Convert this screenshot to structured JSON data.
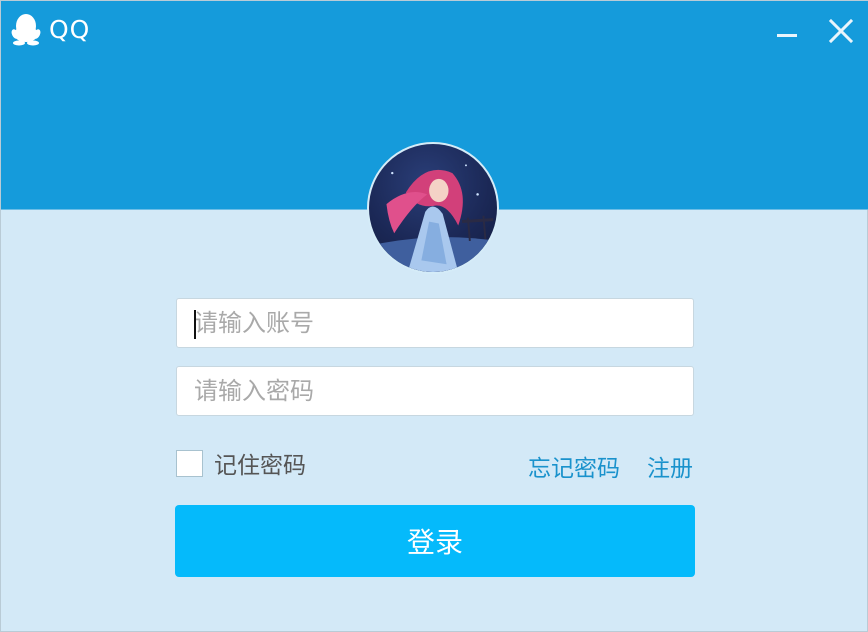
{
  "app": {
    "title": "QQ",
    "logo_icon": "penguin-icon"
  },
  "window_controls": {
    "minimize_icon": "minimize-icon",
    "close_icon": "close-icon"
  },
  "colors": {
    "header": "#159bdb",
    "body": "#d3e9f7",
    "login_button": "#05bafb",
    "link": "#1a92cc"
  },
  "form": {
    "account_placeholder": "请输入账号",
    "account_value": "",
    "password_placeholder": "请输入密码",
    "password_value": "",
    "remember_label": "记住密码",
    "remember_checked": false,
    "forgot_label": "忘记密码",
    "register_label": "注册",
    "login_label": "登录"
  }
}
